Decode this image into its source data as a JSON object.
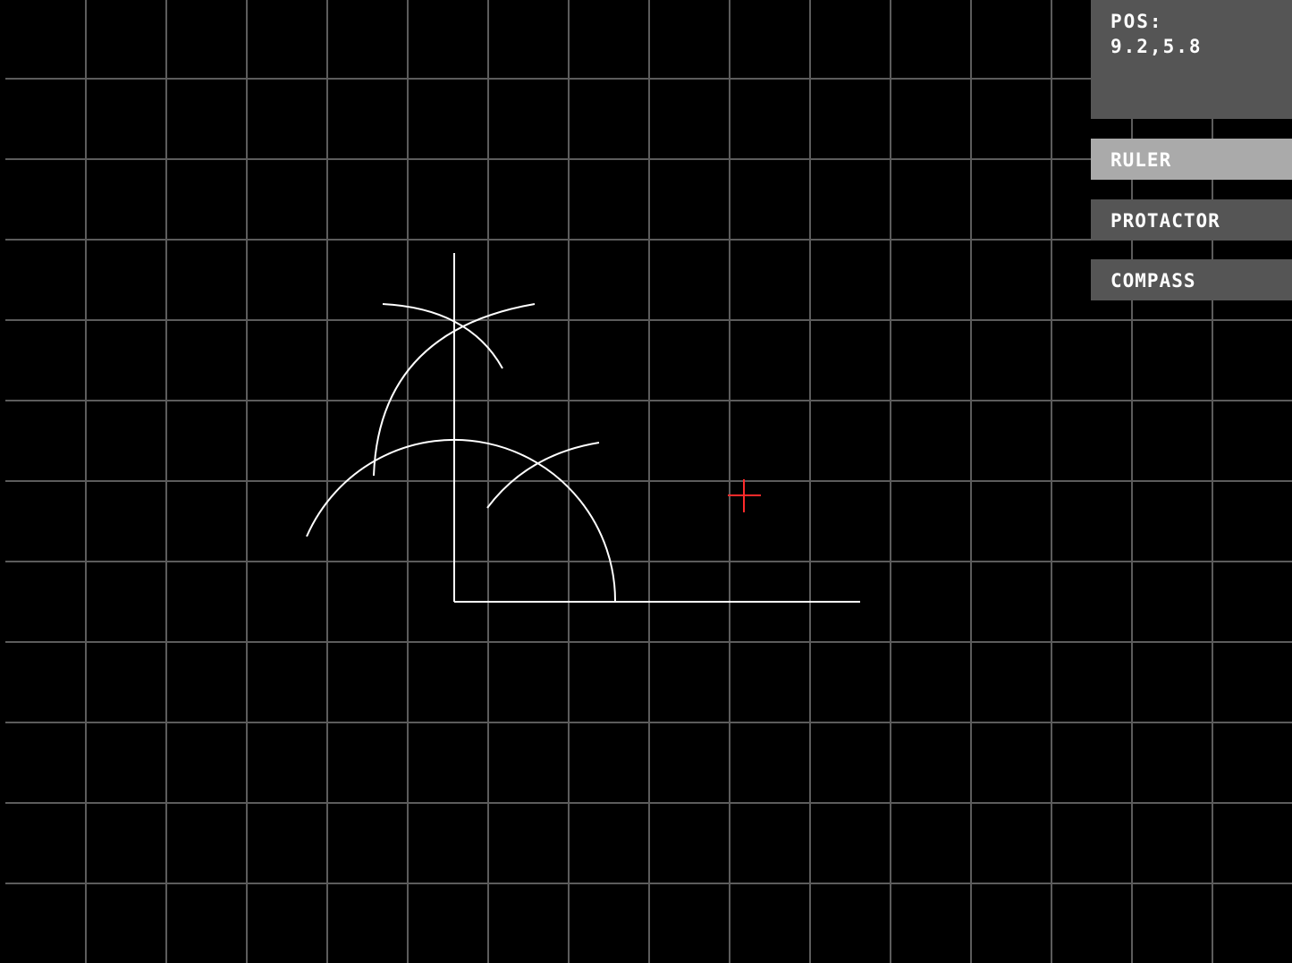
{
  "hud": {
    "pos_label": "POS:",
    "pos_value": "9.2,5.8"
  },
  "tools": {
    "ruler_label": "RULER",
    "protractor_label": "PROTACTOR",
    "compass_label": "COMPASS",
    "active": "ruler"
  },
  "colors": {
    "background": "#000000",
    "grid": "#5c5c5c",
    "construction": "#ffffff",
    "cursor": "#ff2a2a",
    "panel": "#555555",
    "active_button": "#aaaaaa"
  },
  "icons": {
    "cursor": "crosshair-icon"
  }
}
